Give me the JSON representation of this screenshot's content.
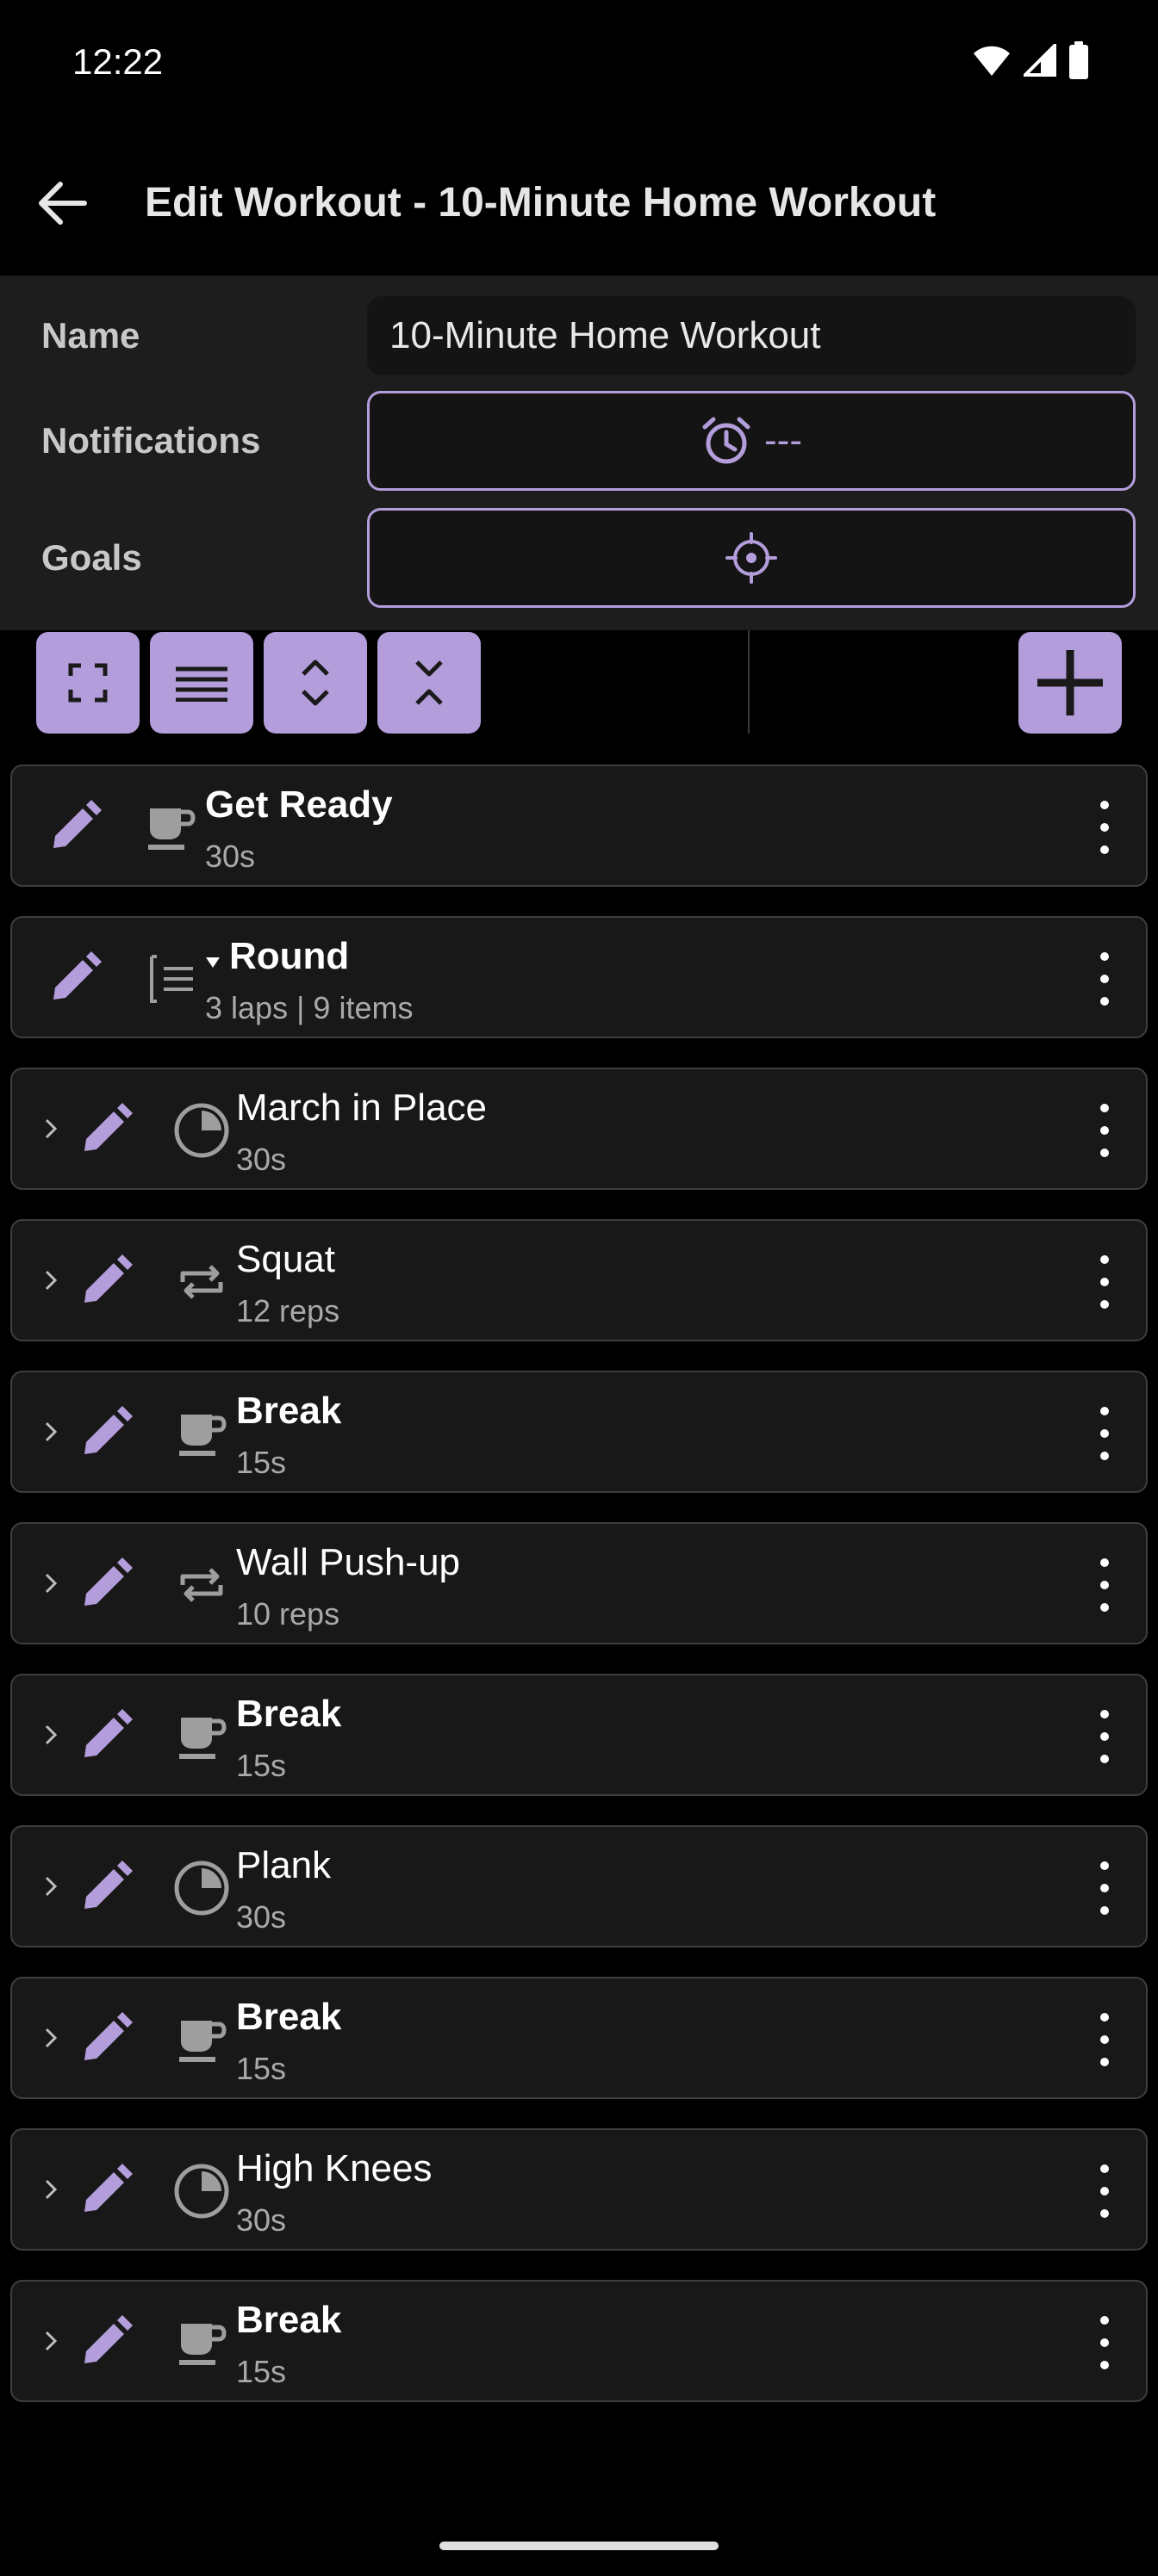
{
  "status_bar": {
    "time": "12:22"
  },
  "app_bar": {
    "title": "Edit Workout - 10-Minute Home Workout"
  },
  "form": {
    "name_label": "Name",
    "name_value": "10-Minute Home Workout",
    "notifications_label": "Notifications",
    "notifications_value": "---",
    "goals_label": "Goals"
  },
  "colors": {
    "accent": "#b39ddb",
    "background": "#000000",
    "panel": "#1d1d1d",
    "row_bg": "#181818",
    "row_border": "#3e3e3e"
  },
  "toolbar": {
    "buttons": [
      "expand-icon",
      "list-icon",
      "expand-all-icon",
      "collapse-all-icon"
    ],
    "add_button": "plus-icon"
  },
  "items": [
    {
      "title": "Get Ready",
      "subtitle": "30s",
      "type": "break",
      "bold": true,
      "nested": false
    },
    {
      "title": "Round",
      "subtitle": "3 laps | 9 items",
      "type": "round",
      "bold": true,
      "nested": false,
      "expanded": true
    },
    {
      "title": "March in Place",
      "subtitle": "30s",
      "type": "timed",
      "bold": false,
      "nested": true
    },
    {
      "title": "Squat",
      "subtitle": "12 reps",
      "type": "reps",
      "bold": false,
      "nested": true
    },
    {
      "title": "Break",
      "subtitle": "15s",
      "type": "break",
      "bold": true,
      "nested": true
    },
    {
      "title": "Wall Push-up",
      "subtitle": "10 reps",
      "type": "reps",
      "bold": false,
      "nested": true
    },
    {
      "title": "Break",
      "subtitle": "15s",
      "type": "break",
      "bold": true,
      "nested": true
    },
    {
      "title": "Plank",
      "subtitle": "30s",
      "type": "timed",
      "bold": false,
      "nested": true
    },
    {
      "title": "Break",
      "subtitle": "15s",
      "type": "break",
      "bold": true,
      "nested": true
    },
    {
      "title": "High Knees",
      "subtitle": "30s",
      "type": "timed",
      "bold": false,
      "nested": true
    },
    {
      "title": "Break",
      "subtitle": "15s",
      "type": "break",
      "bold": true,
      "nested": true
    }
  ]
}
